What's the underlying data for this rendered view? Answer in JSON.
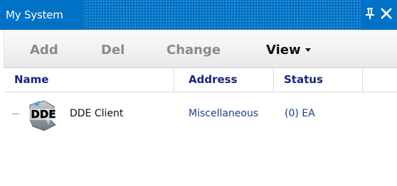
{
  "window": {
    "title": "My System",
    "pin_icon": "pin-icon",
    "close_icon": "close-icon",
    "title_bar_color": "#0072c6"
  },
  "toolbar": {
    "add_label": "Add",
    "del_label": "Del",
    "change_label": "Change",
    "view_label": "View",
    "view_icon": "caret-down-icon"
  },
  "columns": {
    "name": "Name",
    "address": "Address",
    "status": "Status"
  },
  "rows": [
    {
      "icon": "dde-icon",
      "icon_text": "DDE",
      "name": "DDE Client",
      "address": "Miscellaneous",
      "status": "(0) EA"
    }
  ],
  "colors": {
    "header_text": "#1a237e",
    "link_text": "#1a3d8f",
    "toolbar_disabled": "#8a8a8a"
  }
}
